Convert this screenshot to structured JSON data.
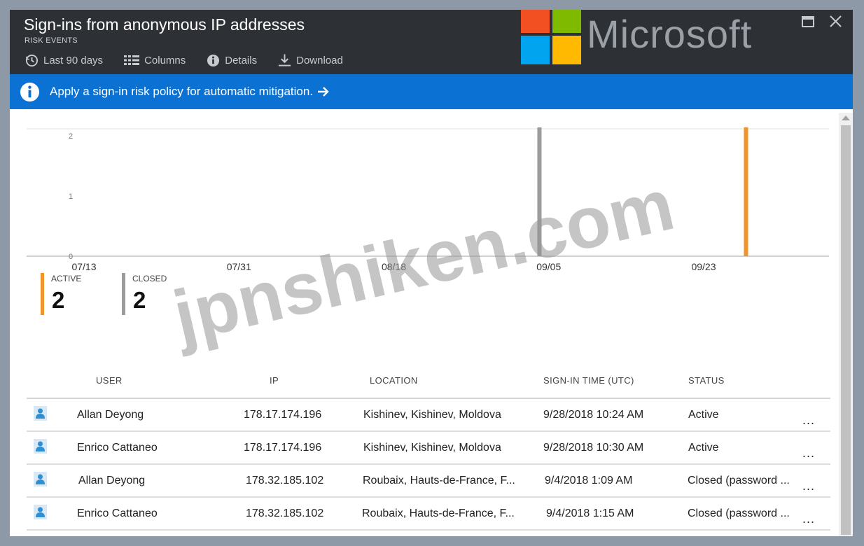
{
  "header": {
    "title": "Sign-ins from anonymous IP addresses",
    "subtitle": "RISK EVENTS",
    "toolbar": [
      {
        "label": "Last 90 days",
        "icon": "clock-icon"
      },
      {
        "label": "Columns",
        "icon": "columns-icon"
      },
      {
        "label": "Details",
        "icon": "info-icon"
      },
      {
        "label": "Download",
        "icon": "download-icon"
      }
    ],
    "window_buttons": [
      "maximize-icon",
      "close-icon"
    ]
  },
  "logo": {
    "text": "Microsoft",
    "colors": [
      "#f25022",
      "#7fba00",
      "#00a4ef",
      "#ffb900"
    ]
  },
  "banner": {
    "text": "Apply a sign-in risk policy for automatic mitigation.",
    "color": "#0b72d3"
  },
  "chart_data": {
    "type": "bar",
    "x_ticks": [
      "07/13",
      "07/31",
      "08/18",
      "09/05",
      "09/23"
    ],
    "ylim": [
      0,
      2
    ],
    "y_ticks": [
      "0",
      "1",
      "2"
    ],
    "series": [
      {
        "name": "CLOSED",
        "color": "#9b9b9b",
        "points": [
          {
            "x": "09/04",
            "y": 2
          }
        ]
      },
      {
        "name": "ACTIVE",
        "color": "#f0932b",
        "points": [
          {
            "x": "09/28",
            "y": 2
          }
        ]
      }
    ]
  },
  "legend": [
    {
      "label": "ACTIVE",
      "value": "2",
      "color": "#f0932b"
    },
    {
      "label": "CLOSED",
      "value": "2",
      "color": "#9b9b9b"
    }
  ],
  "table": {
    "columns": [
      "USER",
      "IP",
      "LOCATION",
      "SIGN-IN TIME (UTC)",
      "STATUS"
    ],
    "rows": [
      {
        "user": "Allan Deyong",
        "ip": "178.17.174.196",
        "location": "Kishinev, Kishinev, Moldova",
        "time": "9/28/2018 10:24 AM",
        "status": "Active",
        "more": "..."
      },
      {
        "user": "Enrico Cattaneo",
        "ip": "178.17.174.196",
        "location": "Kishinev, Kishinev, Moldova",
        "time": "9/28/2018 10:30 AM",
        "status": "Active",
        "more": "..."
      },
      {
        "user": "Allan Deyong",
        "ip": "178.32.185.102",
        "location": "Roubaix, Hauts-de-France, F...",
        "time": "9/4/2018 1:09 AM",
        "status": "Closed (password ...",
        "more": "..."
      },
      {
        "user": "Enrico Cattaneo",
        "ip": "178.32.185.102",
        "location": "Roubaix, Hauts-de-France, F...",
        "time": "9/4/2018 1:15 AM",
        "status": "Closed (password ...",
        "more": "..."
      }
    ]
  },
  "watermark": "jpnshiken.com"
}
